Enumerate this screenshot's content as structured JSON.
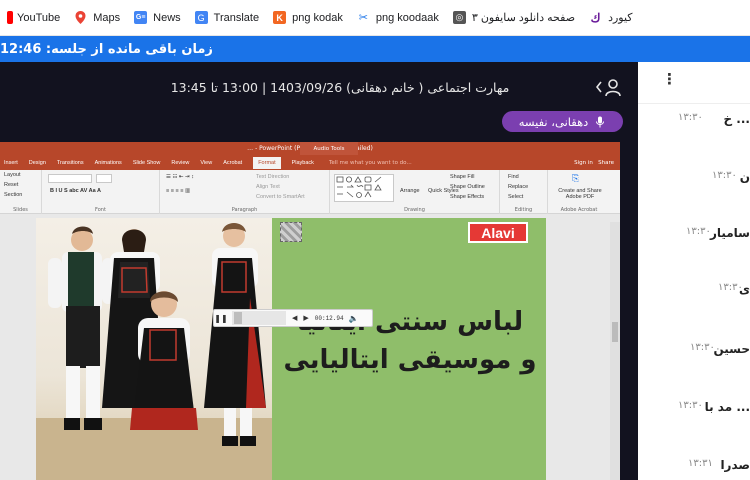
{
  "bookmarks": [
    {
      "label": "YouTube",
      "icon": "youtube-icon"
    },
    {
      "label": "Maps",
      "icon": "maps-icon"
    },
    {
      "label": "News",
      "icon": "news-icon"
    },
    {
      "label": "Translate",
      "icon": "translate-icon"
    },
    {
      "label": "png kodak",
      "icon": "kodak-icon"
    },
    {
      "label": "png koodaak",
      "icon": "koodaak-icon"
    },
    {
      "label": "صفحه دانلود سایفون ۳",
      "icon": "globe-icon"
    },
    {
      "label": "کیورد",
      "icon": "keyword-icon"
    }
  ],
  "timer": {
    "label": "زمان باقی مانده از جلسه: 12:46"
  },
  "session": {
    "title": "مهارت اجتماعی ( خانم دهقانی) 1403/09/26 | 13:00 تا 13:45"
  },
  "speaker": {
    "name": "دهقانی، نفیسه"
  },
  "ppt": {
    "window_title": "… - PowerPoint (Product Activation Failed)",
    "tool_tab": "Audio Tools",
    "tabs": [
      "Insert",
      "Design",
      "Transitions",
      "Animations",
      "Slide Show",
      "Review",
      "View",
      "Acrobat",
      "Format",
      "Playback"
    ],
    "tell_me": "Tell me what you want to do...",
    "sign_in": "Sign in",
    "share": "Share",
    "ribbon": {
      "slides_items": [
        "Layout",
        "Reset",
        "Section"
      ],
      "slides_label": "Slides",
      "font_label": "Font",
      "paragraph_items": [
        "Text Direction",
        "Align Text",
        "Convert to SmartArt"
      ],
      "paragraph_label": "Paragraph",
      "drawing_items": [
        "Arrange",
        "Quick Styles",
        "Shape Fill",
        "Shape Outline",
        "Shape Effects"
      ],
      "drawing_label": "Drawing",
      "editing_items": [
        "Find",
        "Replace",
        "Select"
      ],
      "editing_label": "Editing",
      "adobe_item": "Create and Share Adobe PDF",
      "adobe_label": "Adobe Acrobat"
    },
    "slide": {
      "logo": "Alavi",
      "line1": "لباس سنتی ایتالیا",
      "line2": "و موسیقی ایتالیایی"
    },
    "media": {
      "time": "00:12.94"
    }
  },
  "chat": [
    {
      "name": "... خ",
      "time": "۱۳:۳۰"
    },
    {
      "name": "ن",
      "time": "۱۳:۳۰"
    },
    {
      "name": "سامیار",
      "time": "۱۳:۳۰"
    },
    {
      "name": "ی",
      "time": "۱۳:۳۰"
    },
    {
      "name": "حسین",
      "time": "۱۳:۳۰"
    },
    {
      "name": "... مد با",
      "time": "۱۳:۳۰"
    },
    {
      "name": "صدرا",
      "time": "۱۳:۳۱"
    }
  ],
  "colors": {
    "timer_bar": "#1a73e8",
    "class_bg": "#12121f",
    "speaker_chip": "#7b3fb0",
    "ppt_accent": "#b7472a",
    "slide_green": "#8fbe6a"
  }
}
